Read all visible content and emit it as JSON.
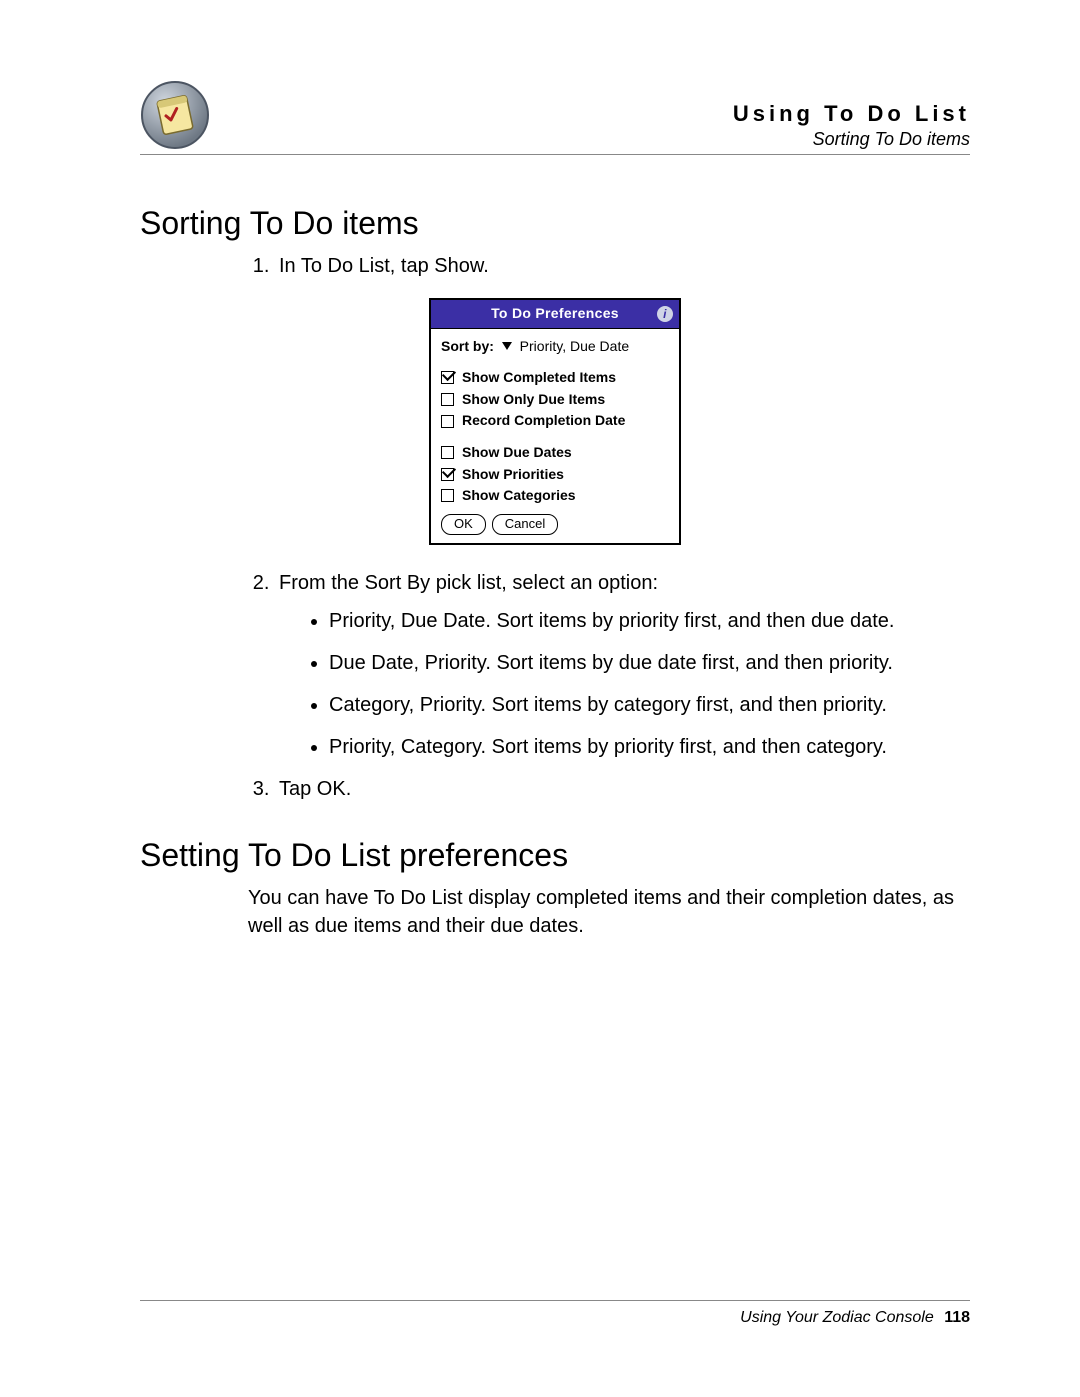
{
  "header": {
    "chapter_title": "Using To Do List",
    "section_title": "Sorting To Do items"
  },
  "section1": {
    "heading": "Sorting To Do items",
    "step1": "In To Do List, tap Show.",
    "step2_intro": "From the Sort By pick list, select an option:",
    "step2_options": {
      "a": "Priority, Due Date. Sort items by priority first, and then due date.",
      "b": "Due Date, Priority. Sort items by due date first, and then priority.",
      "c": "Category, Priority. Sort items by category first, and then priority.",
      "d": "Priority, Category. Sort items by priority first, and then category."
    },
    "step3": "Tap OK."
  },
  "dialog": {
    "title": "To Do Preferences",
    "sort_by_label": "Sort by:",
    "sort_by_value": "Priority, Due Date",
    "checks": {
      "c1": {
        "label": "Show Completed Items",
        "checked": true
      },
      "c2": {
        "label": "Show Only Due Items",
        "checked": false
      },
      "c3": {
        "label": "Record Completion Date",
        "checked": false
      },
      "c4": {
        "label": "Show Due Dates",
        "checked": false
      },
      "c5": {
        "label": "Show Priorities",
        "checked": true
      },
      "c6": {
        "label": "Show Categories",
        "checked": false
      }
    },
    "ok": "OK",
    "cancel": "Cancel"
  },
  "section2": {
    "heading": "Setting To Do List preferences",
    "para": "You can have To Do List display completed items and their completion dates, as well as due items and their due dates."
  },
  "footer": {
    "text": "Using Your Zodiac Console",
    "page": "118"
  }
}
